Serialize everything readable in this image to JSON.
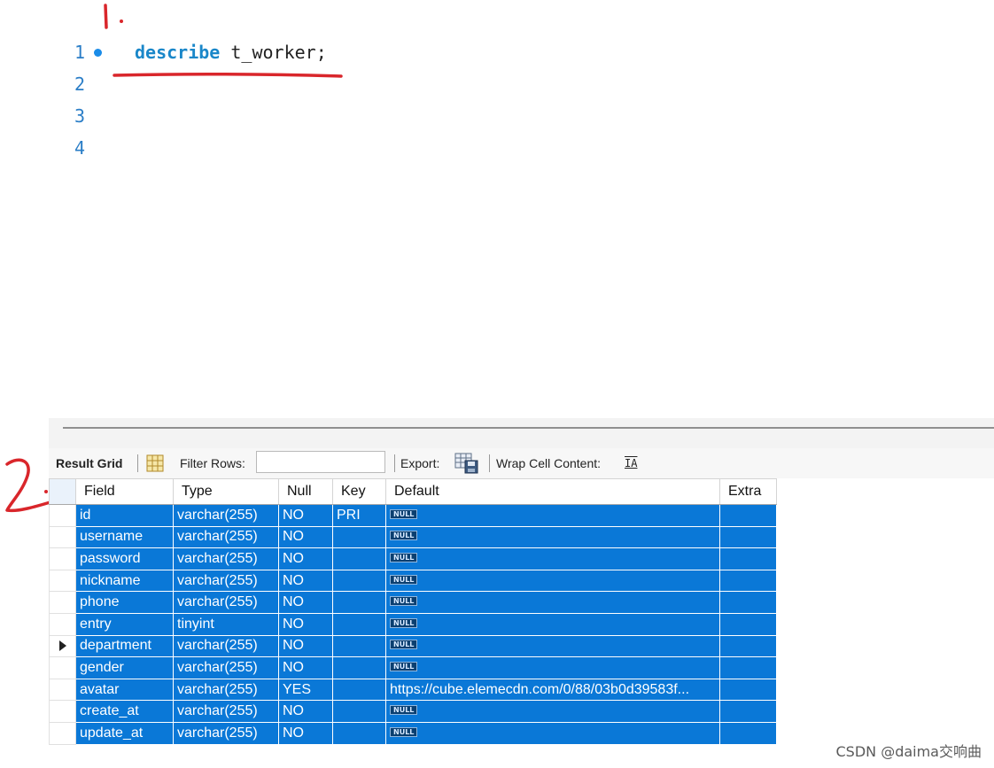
{
  "editor": {
    "lines": [
      {
        "number": "1",
        "keyword": "describe",
        "rest": " t_worker;",
        "has_marker": true
      },
      {
        "number": "2",
        "keyword": "",
        "rest": "",
        "has_marker": false
      },
      {
        "number": "3",
        "keyword": "",
        "rest": "",
        "has_marker": false
      },
      {
        "number": "4",
        "keyword": "",
        "rest": "",
        "has_marker": false
      }
    ]
  },
  "annotations": {
    "mark_1": "1.",
    "mark_2": "2."
  },
  "toolbar": {
    "result_grid_label": "Result Grid",
    "filter_rows_label": "Filter Rows:",
    "filter_value": "",
    "export_label": "Export:",
    "wrap_label": "Wrap Cell Content:",
    "wrap_icon_glyph": "IA"
  },
  "grid": {
    "columns": [
      "Field",
      "Type",
      "Null",
      "Key",
      "Default",
      "Extra"
    ],
    "null_badge": "NULL",
    "rows": [
      {
        "field": "id",
        "type": "varchar(255)",
        "null": "NO",
        "key": "PRI",
        "default": null,
        "extra": "",
        "current": false
      },
      {
        "field": "username",
        "type": "varchar(255)",
        "null": "NO",
        "key": "",
        "default": null,
        "extra": "",
        "current": false
      },
      {
        "field": "password",
        "type": "varchar(255)",
        "null": "NO",
        "key": "",
        "default": null,
        "extra": "",
        "current": false
      },
      {
        "field": "nickname",
        "type": "varchar(255)",
        "null": "NO",
        "key": "",
        "default": null,
        "extra": "",
        "current": false
      },
      {
        "field": "phone",
        "type": "varchar(255)",
        "null": "NO",
        "key": "",
        "default": null,
        "extra": "",
        "current": false
      },
      {
        "field": "entry",
        "type": "tinyint",
        "null": "NO",
        "key": "",
        "default": null,
        "extra": "",
        "current": false
      },
      {
        "field": "department",
        "type": "varchar(255)",
        "null": "NO",
        "key": "",
        "default": null,
        "extra": "",
        "current": true
      },
      {
        "field": "gender",
        "type": "varchar(255)",
        "null": "NO",
        "key": "",
        "default": null,
        "extra": "",
        "current": false
      },
      {
        "field": "avatar",
        "type": "varchar(255)",
        "null": "YES",
        "key": "",
        "default": "https://cube.elemecdn.com/0/88/03b0d39583f...",
        "extra": "",
        "current": false
      },
      {
        "field": "create_at",
        "type": "varchar(255)",
        "null": "NO",
        "key": "",
        "default": null,
        "extra": "",
        "current": false
      },
      {
        "field": "update_at",
        "type": "varchar(255)",
        "null": "NO",
        "key": "",
        "default": null,
        "extra": "",
        "current": false
      }
    ]
  },
  "watermark": "CSDN @daima交响曲",
  "colors": {
    "selection": "#0a78d7",
    "keyword": "#1a87c9",
    "annotation": "#d9262b"
  }
}
